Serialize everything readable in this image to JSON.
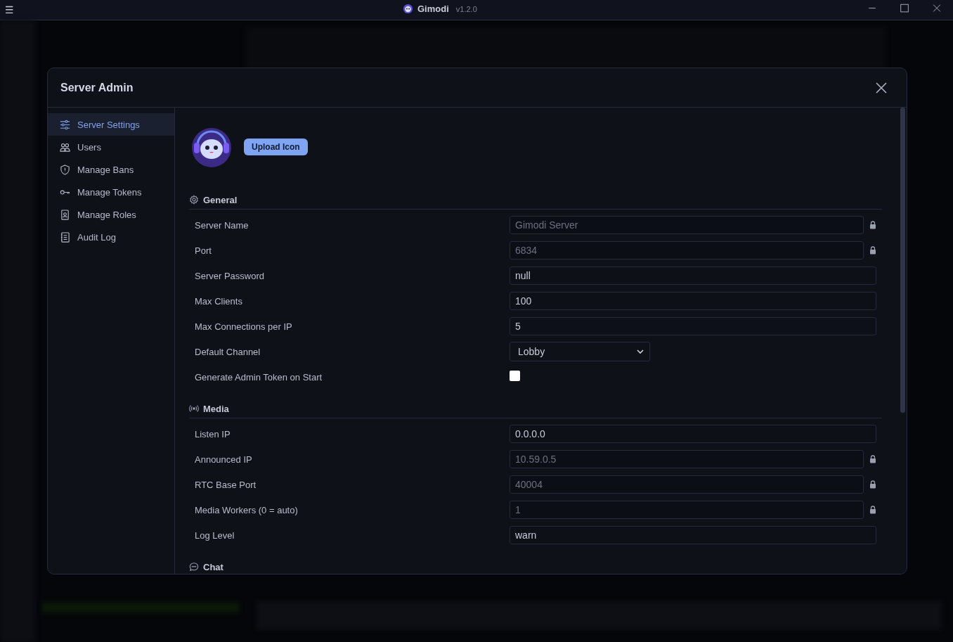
{
  "titlebar": {
    "app_name": "Gimodi",
    "version": "v1.2.0",
    "menu_glyph": "☰"
  },
  "dialog": {
    "title": "Server Admin",
    "nav": [
      {
        "label": "Server Settings",
        "selected": true
      },
      {
        "label": "Users",
        "selected": false
      },
      {
        "label": "Manage Bans",
        "selected": false
      },
      {
        "label": "Manage Tokens",
        "selected": false
      },
      {
        "label": "Manage Roles",
        "selected": false
      },
      {
        "label": "Audit Log",
        "selected": false
      }
    ],
    "upload_button": "Upload Icon",
    "sections": [
      {
        "title": "General",
        "fields": [
          {
            "label": "Server Name",
            "kind": "text",
            "value": "Gimodi Server",
            "locked": true
          },
          {
            "label": "Port",
            "kind": "text",
            "value": "6834",
            "locked": true
          },
          {
            "label": "Server Password",
            "kind": "text",
            "value": "null",
            "locked": false
          },
          {
            "label": "Max Clients",
            "kind": "text",
            "value": "100",
            "locked": false
          },
          {
            "label": "Max Connections per IP",
            "kind": "text",
            "value": "5",
            "locked": false
          },
          {
            "label": "Default Channel",
            "kind": "select",
            "value": "Lobby"
          },
          {
            "label": "Generate Admin Token on Start",
            "kind": "checkbox",
            "checked": false
          }
        ]
      },
      {
        "title": "Media",
        "fields": [
          {
            "label": "Listen IP",
            "kind": "text",
            "value": "0.0.0.0",
            "locked": false
          },
          {
            "label": "Announced IP",
            "kind": "text",
            "value": "10.59.0.5",
            "locked": true
          },
          {
            "label": "RTC Base Port",
            "kind": "text",
            "value": "40004",
            "locked": true
          },
          {
            "label": "Media Workers (0 = auto)",
            "kind": "text",
            "value": "1",
            "locked": true
          },
          {
            "label": "Log Level",
            "kind": "text",
            "value": "warn",
            "locked": false
          }
        ]
      },
      {
        "title": "Chat"
      }
    ]
  }
}
